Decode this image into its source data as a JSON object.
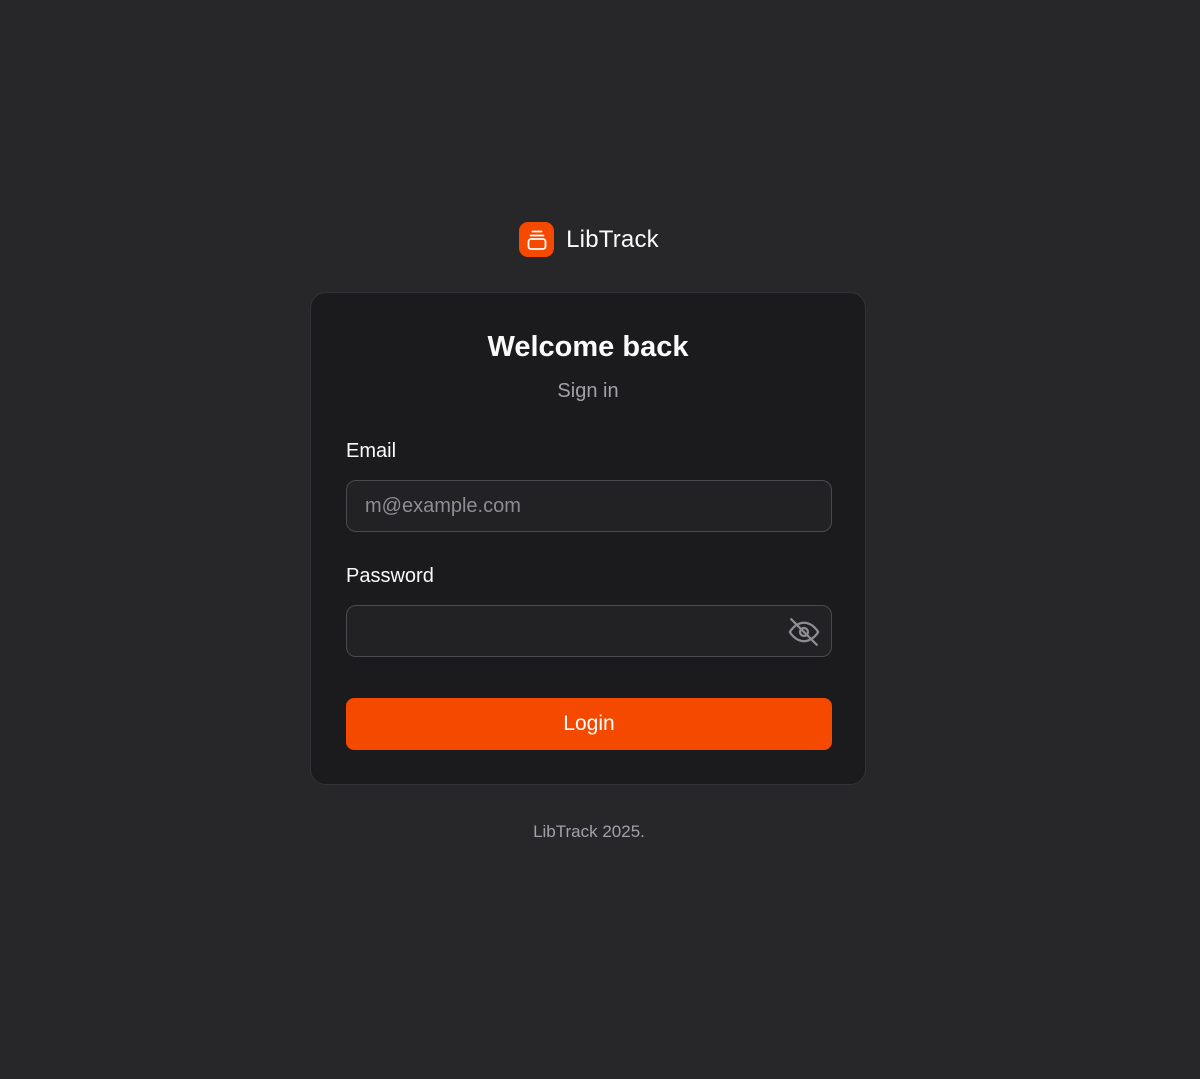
{
  "brand": {
    "name": "LibTrack",
    "logo_icon": "library-icon",
    "accent_color": "#f54900"
  },
  "card": {
    "title": "Welcome back",
    "subtitle": "Sign in"
  },
  "email": {
    "label": "Email",
    "value": "",
    "placeholder": "m@example.com"
  },
  "password": {
    "label": "Password",
    "value": "",
    "placeholder": "",
    "toggle_icon": "eye-off-icon"
  },
  "login": {
    "label": "Login"
  },
  "footer": {
    "text": "LibTrack 2025."
  }
}
